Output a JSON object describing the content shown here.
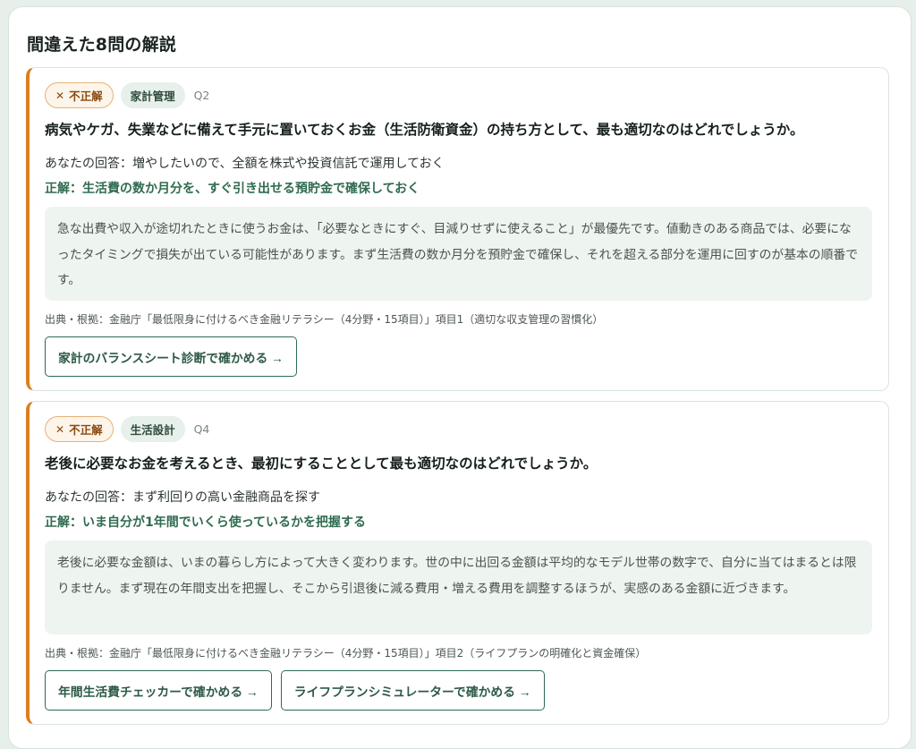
{
  "section": {
    "title": "間違えた8問の解説"
  },
  "labels": {
    "your_answer": "あなたの回答：",
    "correct_answer": "正解："
  },
  "items": [
    {
      "badge": "不正解",
      "badge_icon": "x-icon",
      "category": "家計管理",
      "qnum": "Q2",
      "question": "病気やケガ、失業などに備えて手元に置いておくお金（生活防衛資金）の持ち方として、最も適切なのはどれでしょうか。",
      "your_answer": "増やしたいので、全額を株式や投資信託で運用しておく",
      "correct_answer": "生活費の数か月分を、すぐ引き出せる預貯金で確保しておく",
      "explanation": "急な出費や収入が途切れたときに使うお金は、「必要なときにすぐ、目減りせずに使えること」が最優先です。値動きのある商品では、必要になったタイミングで損失が出ている可能性があります。まず生活費の数か月分を預貯金で確保し、それを超える部分を運用に回すのが基本の順番です。",
      "source": "出典・根拠：金融庁「最低限身に付けるべき金融リテラシー（4分野・15項目）」項目1（適切な収支管理の習慣化）",
      "buttons": [
        "家計のバランスシート診断で確かめる →"
      ]
    },
    {
      "badge": "不正解",
      "badge_icon": "x-icon",
      "category": "生活設計",
      "qnum": "Q4",
      "question": "老後に必要なお金を考えるとき、最初にすることとして最も適切なのはどれでしょうか。",
      "your_answer": "まず利回りの高い金融商品を探す",
      "correct_answer": "いま自分が1年間でいくら使っているかを把握する",
      "explanation": "老後に必要な金額は、いまの暮らし方によって大きく変わります。世の中に出回る金額は平均的なモデル世帯の数字で、自分に当てはまるとは限りません。まず現在の年間支出を把握し、そこから引退後に減る費用・増える費用を調整するほうが、実感のある金額に近づきます。",
      "source": "出典・根拠：金融庁「最低限身に付けるべき金融リテラシー（4分野・15項目）」項目2（ライフプランの明確化と資金確保）",
      "buttons": [
        "年間生活費チェッカーで確かめる →",
        "ライフプランシミュレーターで確かめる →"
      ]
    }
  ]
}
